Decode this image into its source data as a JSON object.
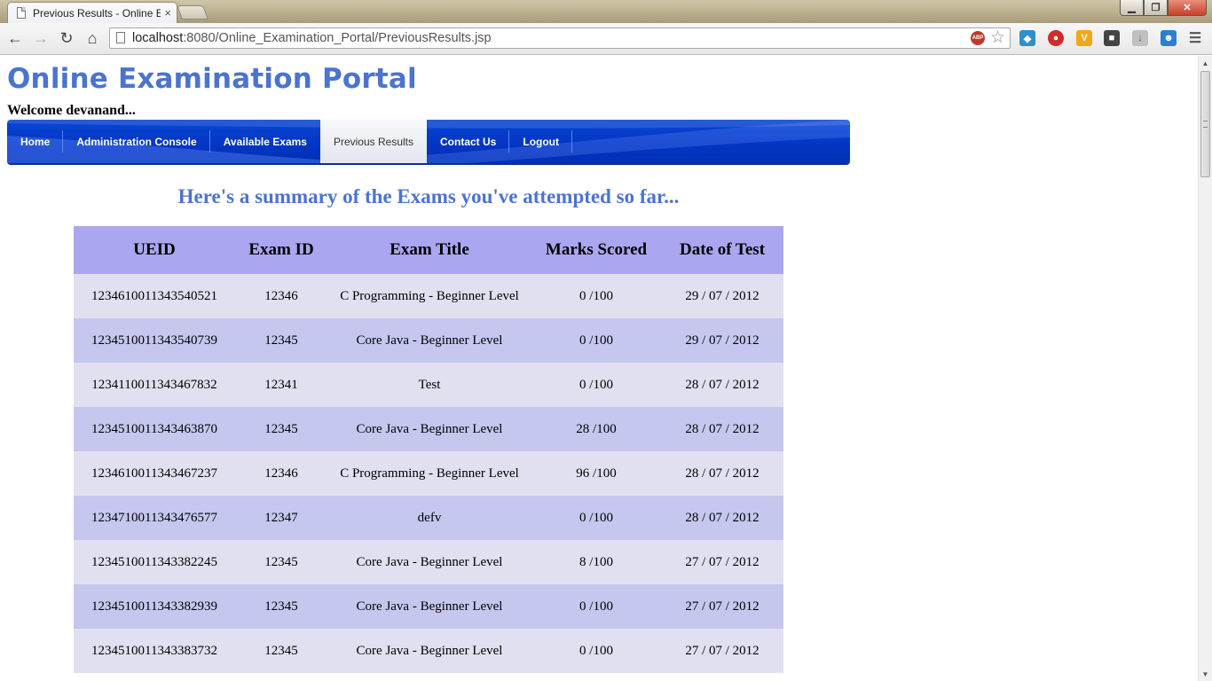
{
  "browser": {
    "tab_title": "Previous Results - Online E",
    "tab_close": "×",
    "url_host": "localhost",
    "url_rest": ":8080/Online_Examination_Portal/PreviousResults.jsp",
    "abp_label": "ABP",
    "window_buttons": {
      "minimize": "▁",
      "maximize": "❐",
      "close": "✕"
    }
  },
  "site": {
    "title": "Online Examination Portal",
    "welcome": "Welcome devanand..."
  },
  "menu": {
    "items": [
      {
        "label": "Home"
      },
      {
        "label": "Administration Console"
      },
      {
        "label": "Available Exams"
      },
      {
        "label": "Previous Results"
      },
      {
        "label": "Contact Us"
      },
      {
        "label": "Logout"
      }
    ],
    "active": "Previous Results"
  },
  "summary_heading": "Here's a summary of the Exams you've attempted so far...",
  "table": {
    "headers": [
      "UEID",
      "Exam ID",
      "Exam Title",
      "Marks Scored",
      "Date of Test"
    ],
    "rows": [
      [
        "1234610011343540521",
        "12346",
        "C Programming - Beginner Level",
        "0 /100",
        "29 / 07 / 2012"
      ],
      [
        "1234510011343540739",
        "12345",
        "Core Java - Beginner Level",
        "0 /100",
        "29 / 07 / 2012"
      ],
      [
        "1234110011343467832",
        "12341",
        "Test",
        "0 /100",
        "28 / 07 / 2012"
      ],
      [
        "1234510011343463870",
        "12345",
        "Core Java - Beginner Level",
        "28 /100",
        "28 / 07 / 2012"
      ],
      [
        "1234610011343467237",
        "12346",
        "C Programming - Beginner Level",
        "96 /100",
        "28 / 07 / 2012"
      ],
      [
        "1234710011343476577",
        "12347",
        "defv",
        "0 /100",
        "28 / 07 / 2012"
      ],
      [
        "1234510011343382245",
        "12345",
        "Core Java - Beginner Level",
        "8 /100",
        "27 / 07 / 2012"
      ],
      [
        "1234510011343382939",
        "12345",
        "Core Java - Beginner Level",
        "0 /100",
        "27 / 07 / 2012"
      ],
      [
        "1234510011343383732",
        "12345",
        "Core Java - Beginner Level",
        "0 /100",
        "27 / 07 / 2012"
      ]
    ]
  },
  "colors": {
    "title_blue": "#4b74cf",
    "menu_blue": "#0336c4",
    "header_row": "#aaa6ef",
    "row_light": "#e0e0f0",
    "row_dark": "#c6c7ef"
  }
}
